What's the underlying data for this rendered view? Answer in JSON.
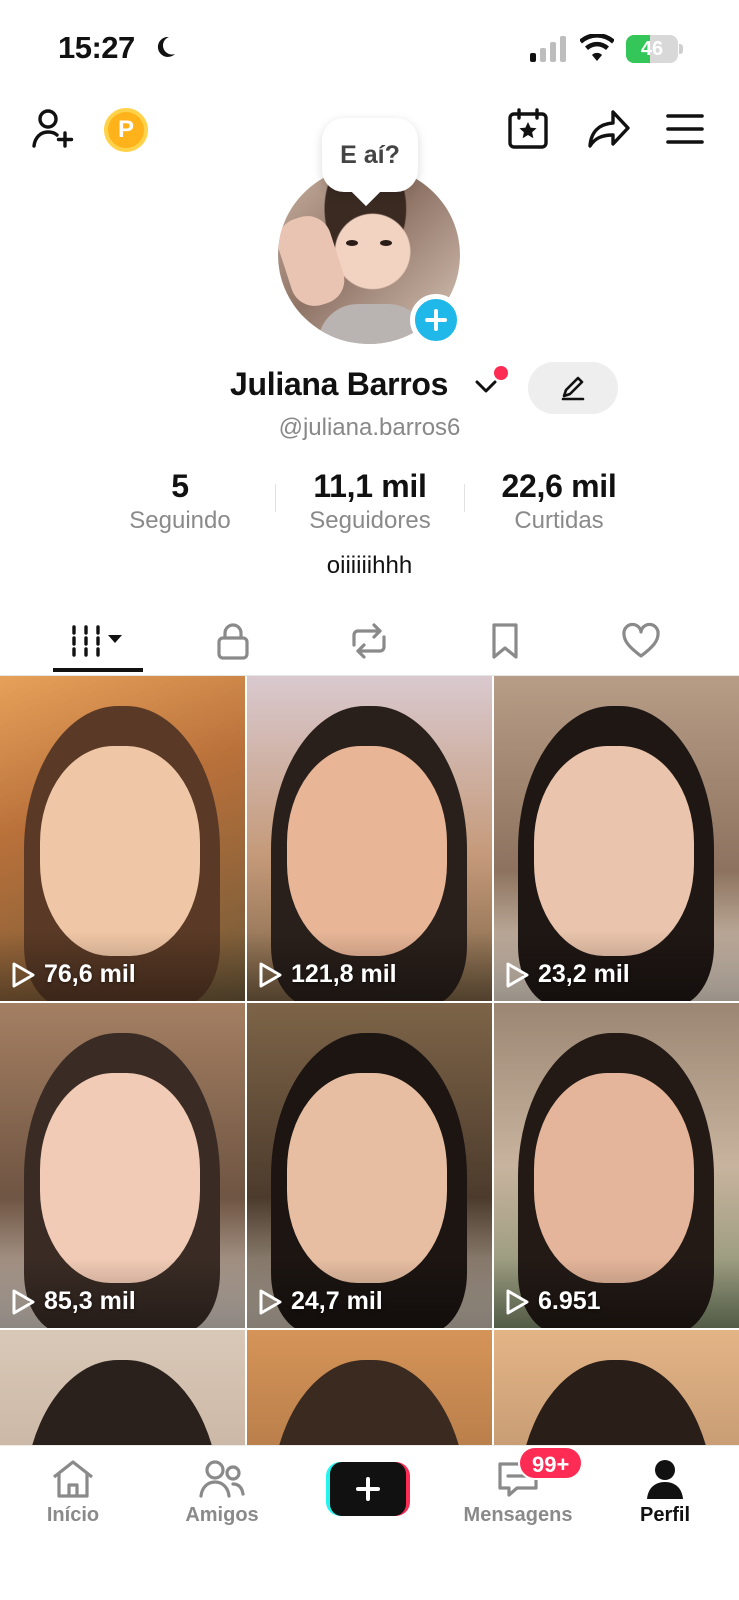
{
  "status_bar": {
    "time": "15:27",
    "battery": "46",
    "battery_level_percent": 46
  },
  "speech_bubble": "E aí?",
  "profile": {
    "name": "Juliana Barros",
    "handle": "@juliana.barros6",
    "bio": "oiiiiiihhh"
  },
  "stats": [
    {
      "value": "5",
      "label": "Seguindo"
    },
    {
      "value": "11,1 mil",
      "label": "Seguidores"
    },
    {
      "value": "22,6 mil",
      "label": "Curtidas"
    }
  ],
  "tabs": [
    "videos-icon",
    "lock-icon",
    "repost-icon",
    "bookmark-icon",
    "heart-icon"
  ],
  "videos": [
    {
      "views": "76,6 mil"
    },
    {
      "views": "121,8 mil"
    },
    {
      "views": "23,2 mil"
    },
    {
      "views": "85,3 mil"
    },
    {
      "views": "24,7 mil"
    },
    {
      "views": "6.951"
    }
  ],
  "bottom_nav": {
    "home": "Início",
    "friends": "Amigos",
    "messages": "Mensagens",
    "messages_badge": "99+",
    "profile": "Perfil"
  },
  "colors": {
    "accent": "#fe2c55",
    "cyan": "#25f4ee",
    "add_blue": "#1fb8e8",
    "coin": "#ffb21a"
  }
}
